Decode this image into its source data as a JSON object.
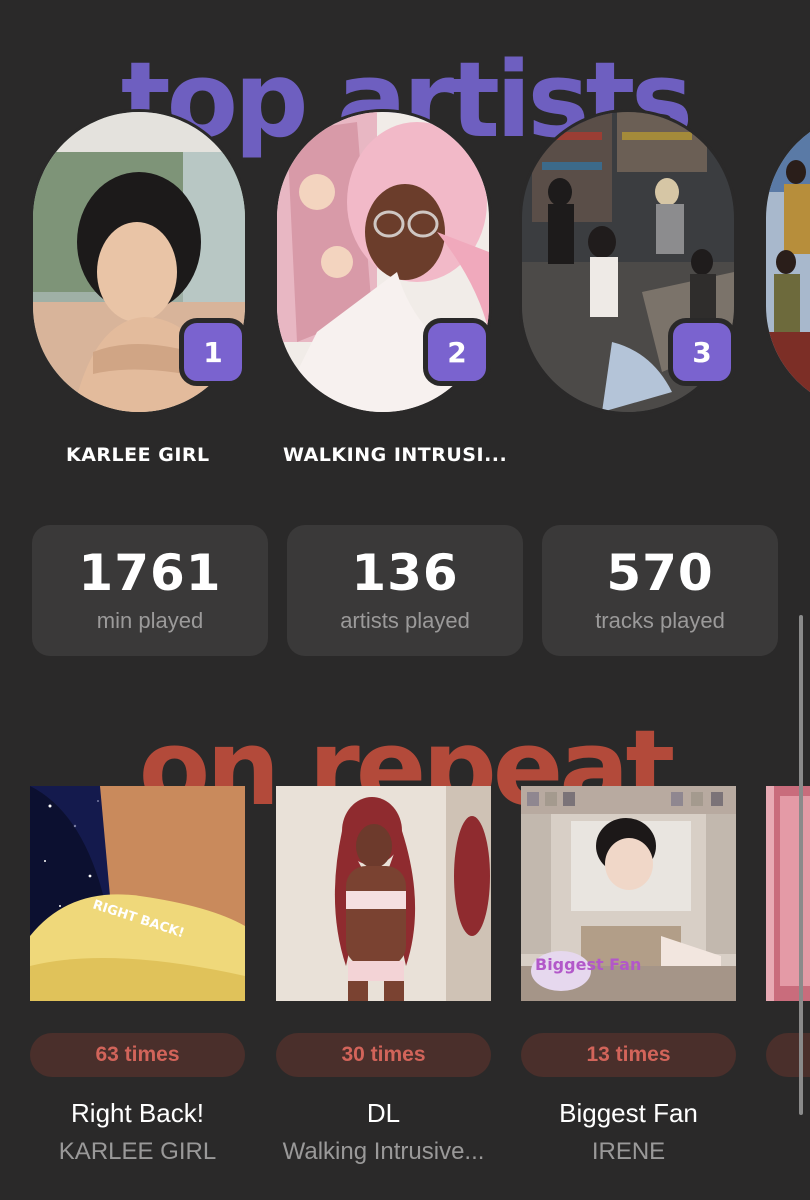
{
  "top_artists": {
    "heading": "top artists",
    "accent_color": "#7a63cf",
    "items": [
      {
        "rank": "1",
        "name": "KARLEE GIRL"
      },
      {
        "rank": "2",
        "name": "WALKING INTRUSI..."
      },
      {
        "rank": "3",
        "name": ""
      }
    ]
  },
  "stats": [
    {
      "value": "1761",
      "label": "min played"
    },
    {
      "value": "136",
      "label": "artists played"
    },
    {
      "value": "570",
      "label": "tracks played"
    }
  ],
  "on_repeat": {
    "heading": "on repeat",
    "accent_color": "#b34a3a",
    "items": [
      {
        "times": "63 times",
        "title": "Right Back!",
        "artist": "KARLEE GIRL",
        "cover_text": "RIGHT BACK!"
      },
      {
        "times": "30 times",
        "title": "DL",
        "artist": "Walking Intrusive..."
      },
      {
        "times": "13 times",
        "title": "Biggest Fan",
        "artist": "IRENE",
        "cover_text": "Biggest Fan"
      }
    ]
  }
}
